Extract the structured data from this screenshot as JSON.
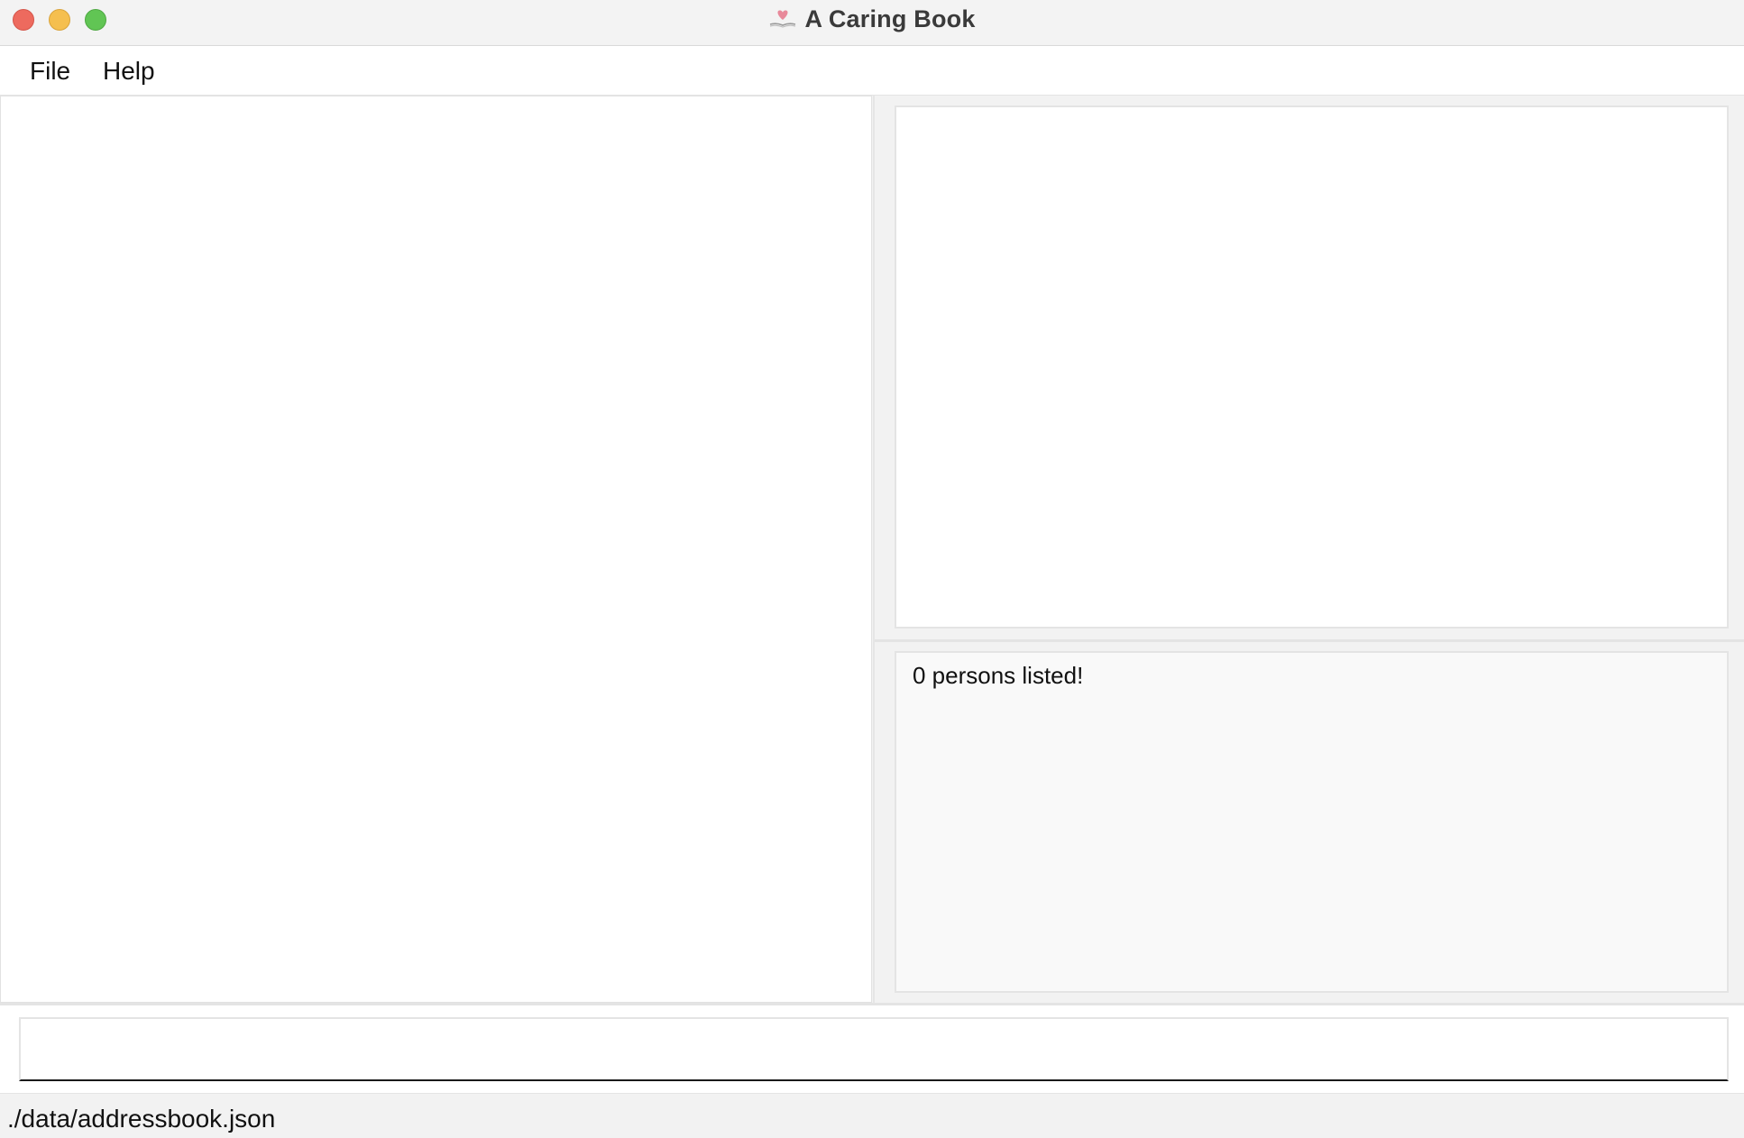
{
  "window": {
    "title": "A Caring Book",
    "app_icon": "heart-book-icon",
    "traffic_lights": {
      "close_color": "#ed6a5e",
      "minimize_color": "#f5bf4f",
      "zoom_color": "#61c554"
    }
  },
  "menu": {
    "items": [
      {
        "label": "File"
      },
      {
        "label": "Help"
      }
    ]
  },
  "person_list": {
    "items": []
  },
  "result_display": {
    "text": ""
  },
  "status": {
    "message": "0 persons listed!"
  },
  "command_box": {
    "value": "",
    "placeholder": ""
  },
  "status_bar": {
    "save_location": "./data/addressbook.json"
  }
}
